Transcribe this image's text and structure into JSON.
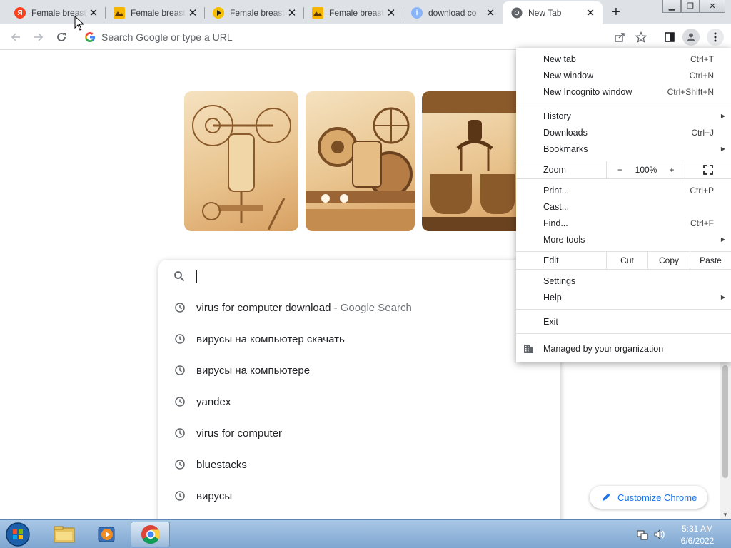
{
  "tabs": [
    {
      "title": "Female breast",
      "icon": "yandex-icon",
      "color": "#fc3f1d",
      "letter": "Я"
    },
    {
      "title": "Female breast",
      "icon": "image-icon",
      "color": "#f6b500",
      "letter": ""
    },
    {
      "title": "Female breast",
      "icon": "play-icon",
      "color": "#f6c000",
      "letter": ""
    },
    {
      "title": "Female breast",
      "icon": "image-icon",
      "color": "#f6b500",
      "letter": ""
    },
    {
      "title": "download co",
      "icon": "info-icon",
      "color": "#8ab4f8",
      "letter": "i"
    },
    {
      "title": "New Tab",
      "icon": "chrome-icon",
      "color": "#5f6368",
      "letter": ""
    }
  ],
  "omnibox": {
    "placeholder": "Search Google or type a URL"
  },
  "suggestions": [
    {
      "text": "virus for computer download",
      "suffix": " - Google Search"
    },
    {
      "text": "вирусы на компьютер скачать",
      "suffix": ""
    },
    {
      "text": "вирусы на компьютере",
      "suffix": ""
    },
    {
      "text": "yandex",
      "suffix": ""
    },
    {
      "text": "virus for computer",
      "suffix": ""
    },
    {
      "text": "bluestacks",
      "suffix": ""
    },
    {
      "text": "вирусы",
      "suffix": ""
    }
  ],
  "customize": {
    "label": "Customize Chrome"
  },
  "menu": {
    "new_tab": {
      "label": "New tab",
      "shortcut": "Ctrl+T"
    },
    "new_window": {
      "label": "New window",
      "shortcut": "Ctrl+N"
    },
    "new_incognito": {
      "label": "New Incognito window",
      "shortcut": "Ctrl+Shift+N"
    },
    "history": {
      "label": "History"
    },
    "downloads": {
      "label": "Downloads",
      "shortcut": "Ctrl+J"
    },
    "bookmarks": {
      "label": "Bookmarks"
    },
    "zoom": {
      "label": "Zoom",
      "minus": "−",
      "value": "100%",
      "plus": "+"
    },
    "print": {
      "label": "Print...",
      "shortcut": "Ctrl+P"
    },
    "cast": {
      "label": "Cast..."
    },
    "find": {
      "label": "Find...",
      "shortcut": "Ctrl+F"
    },
    "more_tools": {
      "label": "More tools"
    },
    "edit": {
      "label": "Edit",
      "cut": "Cut",
      "copy": "Copy",
      "paste": "Paste"
    },
    "settings": {
      "label": "Settings"
    },
    "help": {
      "label": "Help"
    },
    "exit": {
      "label": "Exit"
    },
    "managed": {
      "label": "Managed by your organization"
    }
  },
  "taskbar": {
    "time": "5:31 AM",
    "date": "6/6/2022"
  },
  "colors": {
    "accent": "#1a73e8",
    "tab_strip": "#dee1e6",
    "taskbar": "#8fb3da"
  }
}
